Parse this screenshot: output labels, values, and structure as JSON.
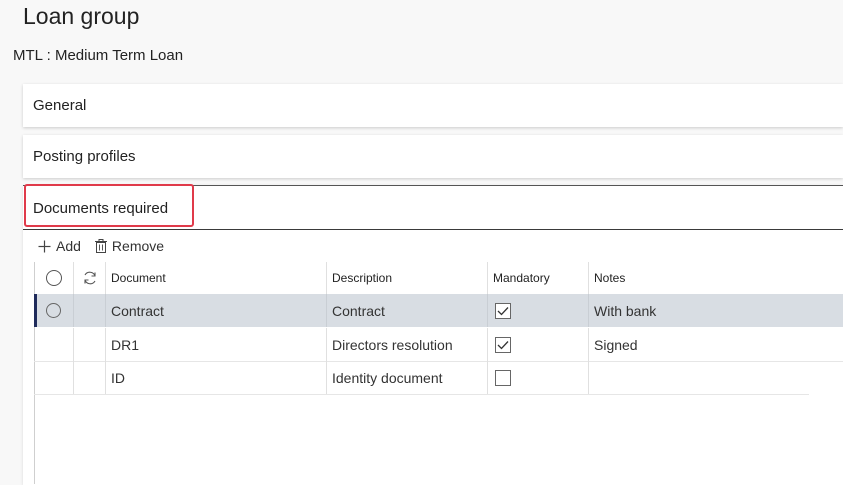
{
  "page": {
    "title": "Loan group",
    "subtitle": "MTL : Medium Term Loan"
  },
  "sections": {
    "general": "General",
    "posting_profiles": "Posting profiles",
    "documents_required": "Documents required"
  },
  "toolbar": {
    "add_label": "Add",
    "remove_label": "Remove"
  },
  "grid": {
    "columns": {
      "document": "Document",
      "description": "Description",
      "mandatory": "Mandatory",
      "notes": "Notes"
    },
    "rows": [
      {
        "document": "Contract",
        "description": "Contract",
        "mandatory": true,
        "notes": "With bank",
        "selected": true
      },
      {
        "document": "DR1",
        "description": "Directors resolution",
        "mandatory": true,
        "notes": "Signed",
        "selected": false
      },
      {
        "document": "ID",
        "description": "Identity document",
        "mandatory": false,
        "notes": "",
        "selected": false
      }
    ]
  },
  "colors": {
    "highlight": "#e03a4a",
    "selected_row": "#d8dde3",
    "selection_bar": "#1f2b5b"
  }
}
